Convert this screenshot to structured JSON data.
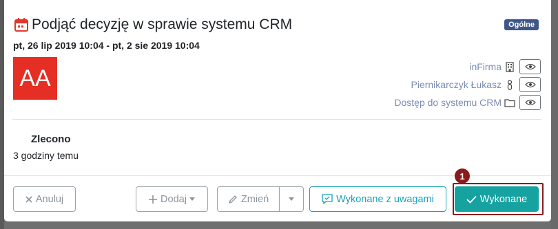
{
  "task": {
    "title": "Podjąć decyzję w sprawie systemu CRM",
    "category_badge": "Ogólne",
    "date_range": "pt, 26 lip 2019 10:04 - pt, 2 sie 2019 10:04",
    "avatar_initials": "AA",
    "meta": [
      {
        "text": "inFirma",
        "icon": "building-icon"
      },
      {
        "text": "Piernikarczyk Łukasz",
        "icon": "user-icon"
      },
      {
        "text": "Dostęp do systemu CRM",
        "icon": "folder-icon"
      }
    ],
    "status_label": "Zlecono",
    "status_time": "3 godziny temu"
  },
  "footer": {
    "cancel_label": "Anuluj",
    "add_label": "Dodaj",
    "edit_label": "Zmień",
    "done_with_notes_label": "Wykonane z uwagami",
    "done_label": "Wykonane"
  },
  "annotation": {
    "step_number": "1"
  },
  "colors": {
    "accent": "#17a2a2",
    "badge": "#3f5788",
    "avatar": "#e52e24",
    "highlight": "#8b1a1a",
    "meta_text": "#7a8db5"
  }
}
